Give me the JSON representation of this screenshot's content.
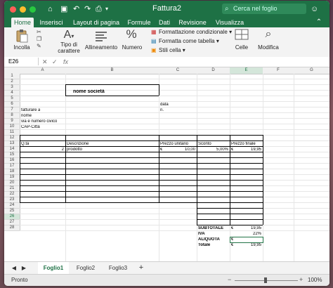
{
  "window": {
    "title": "Fattura2"
  },
  "search": {
    "placeholder": "Cerca nel foglio"
  },
  "tabs": [
    "Home",
    "Inserisci",
    "Layout di pagina",
    "Formule",
    "Dati",
    "Revisione",
    "Visualizza"
  ],
  "ribbon": {
    "paste": "Incolla",
    "font_type": "Tipo di carattere",
    "font_type_l1": "Tipo di",
    "font_type_l2": "carattere",
    "alignment": "Allineamento",
    "number": "Numero",
    "cond_format": "Formattazione condizionale",
    "format_table": "Formatta come tabella",
    "cell_styles": "Stili cella",
    "cells": "Celle",
    "edit": "Modifica"
  },
  "formula_bar": {
    "name_box": "E26",
    "fx": "fx"
  },
  "columns": [
    "A",
    "B",
    "C",
    "D",
    "E",
    "F",
    "G"
  ],
  "rows": [
    "1",
    "2",
    "3",
    "4",
    "5",
    "6",
    "7",
    "8",
    "9",
    "10",
    "11",
    "12",
    "13",
    "14",
    "15",
    "16",
    "17",
    "18",
    "19",
    "20",
    "21",
    "22",
    "23",
    "24",
    "25",
    "26",
    "27",
    "28"
  ],
  "sheet": {
    "company": "nome società",
    "data_label": "data",
    "n_label": "n.",
    "bill_to": "fatturare a",
    "name": "nome",
    "street": "via e numero civico",
    "cap": "CAP-Città",
    "hdr_qta": "Q.tà",
    "hdr_desc": "Descrizione",
    "hdr_price": "Prezzo unitario",
    "hdr_disc": "Sconto",
    "hdr_final": "Prezzo finale",
    "qty": "2",
    "product": "prodotto",
    "euro": "€",
    "unit_price": "10,00",
    "discount": "5,00%",
    "final_price": "19,95",
    "subtotal_label": "SUBTOTALE",
    "subtotal": "19,95",
    "iva_label": "IVA",
    "iva": "22%",
    "aliquota_label": "ALIQUOTA",
    "totale_label": "Totale",
    "totale": "19,95"
  },
  "sheet_tabs": [
    "Foglio1",
    "Foglio2",
    "Foglio3"
  ],
  "status": {
    "text": "Pronto",
    "zoom": "100%"
  },
  "colors": {
    "accent": "#1e7145",
    "selection": "#217346"
  }
}
